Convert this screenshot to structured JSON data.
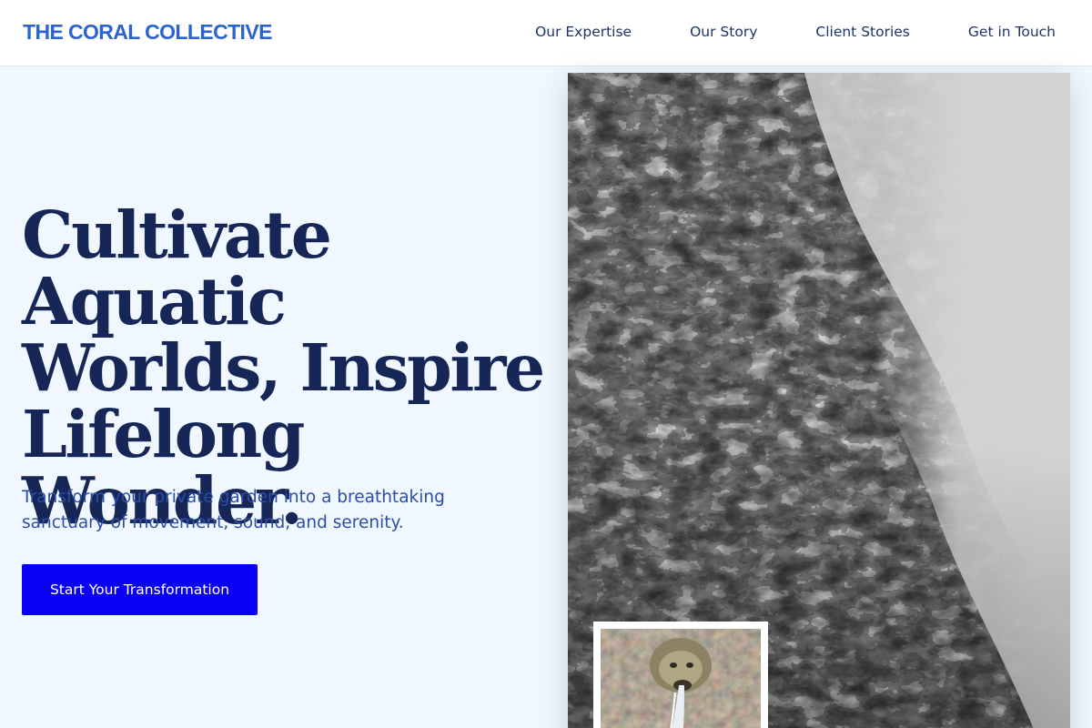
{
  "header": {
    "brand": "THE CORAL COLLECTIVE",
    "nav": [
      {
        "label": "Our Expertise"
      },
      {
        "label": "Our Story"
      },
      {
        "label": "Client Stories"
      },
      {
        "label": "Get in Touch"
      }
    ]
  },
  "hero": {
    "title": "Cultivate Aquatic Worlds, Inspire Lifelong Wonder.",
    "subtitle": "Transform your private garden into a breathtaking sanctuary of movement, sound, and serenity.",
    "cta_label": "Start Your Transformation"
  },
  "colors": {
    "brand": "#2c64cf",
    "heading": "#152657",
    "cta": "#0a00f5",
    "background": "#f0f7ff"
  }
}
